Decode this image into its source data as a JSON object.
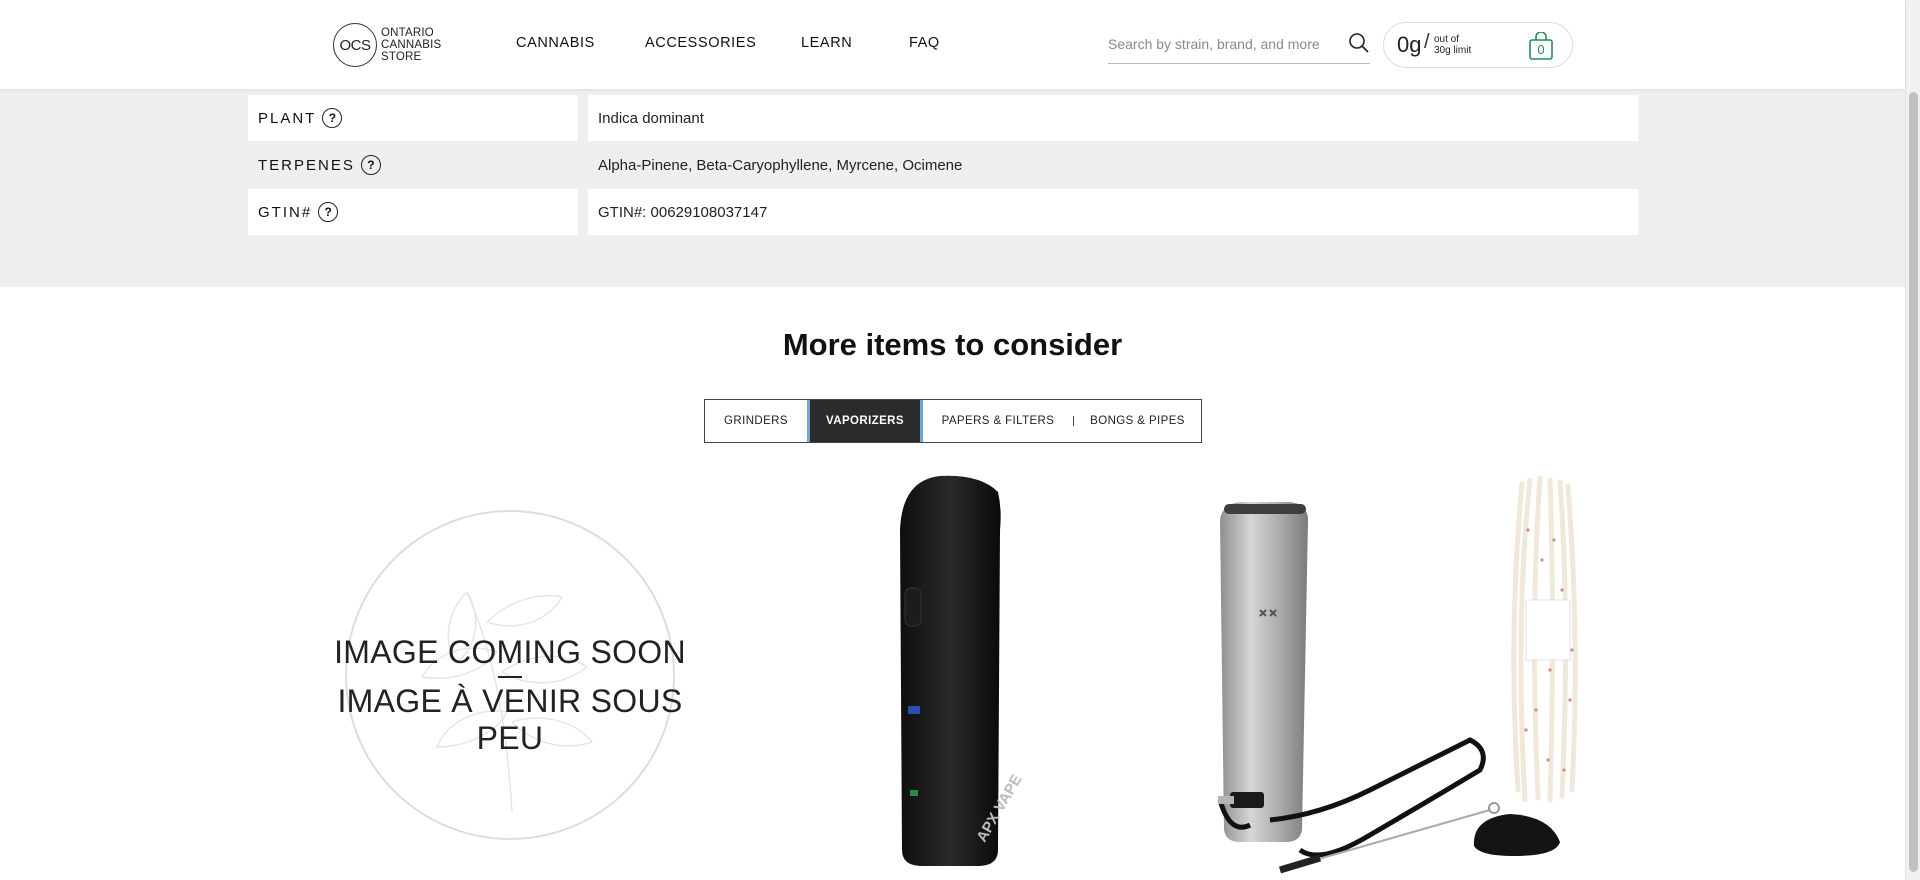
{
  "header": {
    "logo": {
      "mark": "OCS",
      "line1": "ONTARIO",
      "line2": "CANNABIS",
      "line3": "STORE"
    },
    "nav": [
      "CANNABIS",
      "ACCESSORIES",
      "LEARN",
      "FAQ"
    ],
    "search": {
      "placeholder": "Search by strain, brand, and more"
    },
    "limit": {
      "amount": "0g",
      "slash": "/",
      "line1": "out of",
      "line2": "30g limit"
    },
    "cart_count": "0"
  },
  "specs": [
    {
      "label": "PLANT",
      "value": "Indica dominant"
    },
    {
      "label": "TERPENES",
      "value": "Alpha-Pinene, Beta-Caryophyllene, Myrcene, Ocimene"
    },
    {
      "label": "GTIN#",
      "value": "GTIN#: 00629108037147"
    }
  ],
  "help_glyph": "?",
  "more": {
    "title": "More items to consider",
    "tabs": [
      "GRINDERS",
      "VAPORIZERS",
      "PAPERS & FILTERS",
      "BONGS & PIPES"
    ],
    "active_tab": "VAPORIZERS"
  },
  "placeholder_image": {
    "line1": "IMAGE COMING SOON",
    "line2": "IMAGE À VENIR SOUS PEU"
  },
  "vaporizer_logo": "APX VAPE",
  "colors": {
    "accent_tab": "#2b2b2b",
    "tab_border": "#6fa6d6",
    "specs_bg": "#efefef",
    "cart": "#2a8b5b"
  }
}
